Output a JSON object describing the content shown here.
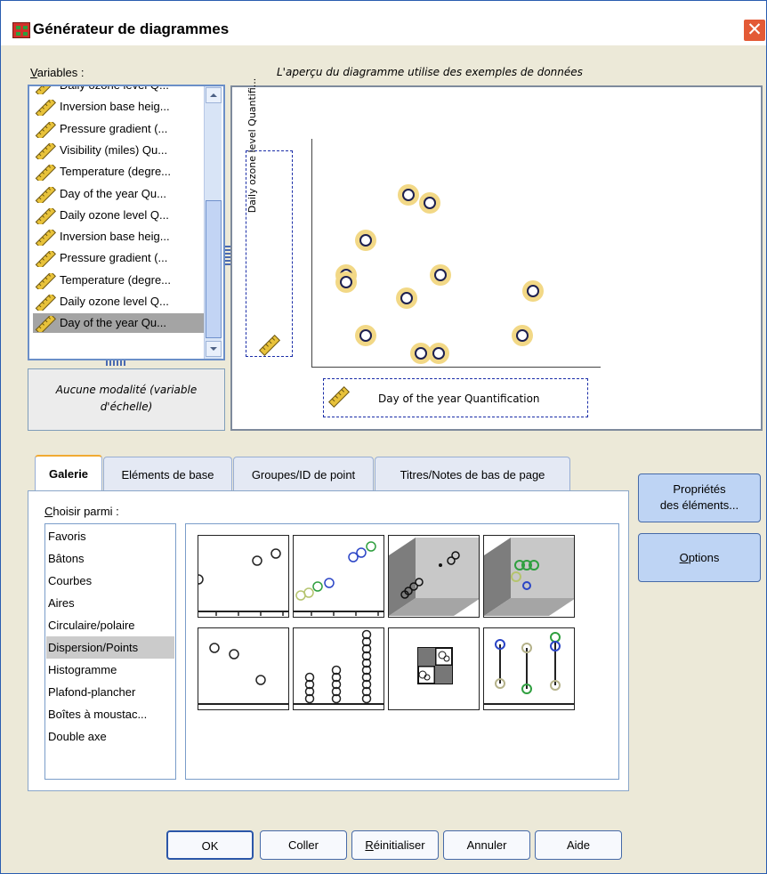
{
  "window": {
    "title": "Générateur de diagrammes",
    "close_icon": "✕"
  },
  "variables": {
    "label": "Variables :",
    "label_underline": "V",
    "label_rest": "ariables :",
    "items": [
      {
        "label": "Daily ozone level Q...",
        "icon": "ruler-icon"
      },
      {
        "label": "Inversion base heig...",
        "icon": "ruler-icon"
      },
      {
        "label": "Pressure gradient (...",
        "icon": "ruler-icon"
      },
      {
        "label": "Visibility (miles) Qu...",
        "icon": "ruler-icon"
      },
      {
        "label": "Temperature (degre...",
        "icon": "ruler-icon"
      },
      {
        "label": "Day of the year Qu...",
        "icon": "ruler-icon"
      },
      {
        "label": "Daily ozone level Q...",
        "icon": "ruler-icon"
      },
      {
        "label": "Inversion base heig...",
        "icon": "ruler-icon"
      },
      {
        "label": "Pressure gradient (...",
        "icon": "ruler-icon"
      },
      {
        "label": "Temperature (degre...",
        "icon": "ruler-icon"
      },
      {
        "label": "Daily ozone level Q...",
        "icon": "ruler-icon"
      },
      {
        "label": "Day of the year Qu...",
        "icon": "ruler-icon",
        "selected": true
      }
    ],
    "no_modality": "Aucune modalité (variable d'échelle)"
  },
  "preview": {
    "caption": "L'aperçu du diagramme utilise des exemples de données",
    "y_axis_label": "Daily ozone level Quantifi...",
    "x_axis_label": "Day of the year Quantification"
  },
  "tabs": [
    {
      "label": "Galerie",
      "active": true
    },
    {
      "label": "Eléments de base"
    },
    {
      "label": "Groupes/ID de point"
    },
    {
      "label": "Titres/Notes de bas de page"
    }
  ],
  "gallery": {
    "choose_label": "Choisir parmi :",
    "choose_underline": "C",
    "choose_rest": "hoisir parmi :",
    "types": [
      "Favoris",
      "Bâtons",
      "Courbes",
      "Aires",
      "Circulaire/polaire",
      "Dispersion/Points",
      "Histogramme",
      "Plafond-plancher",
      "Boîtes à moustac...",
      "Double axe"
    ],
    "selected_type": "Dispersion/Points",
    "thumbnails": [
      "simple-scatter-icon",
      "grouped-scatter-icon",
      "3d-scatter-icon",
      "3d-grouped-scatter-icon",
      "summary-point-icon",
      "dot-plot-icon",
      "scatterplot-matrix-icon",
      "drop-line-icon"
    ]
  },
  "side_buttons": {
    "properties": [
      "Propriétés",
      "des éléments..."
    ],
    "options_label": "Options",
    "options_underline": "O",
    "options_rest": "ptions"
  },
  "footer": {
    "ok": "OK",
    "paste": "Coller",
    "reset_underline": "R",
    "reset_rest": "éinitialiser",
    "cancel": "Annuler",
    "help": "Aide"
  },
  "colors": {
    "accent": "#2b56a8",
    "title_close": "#e35a36",
    "point_halo": "#f2d886"
  }
}
